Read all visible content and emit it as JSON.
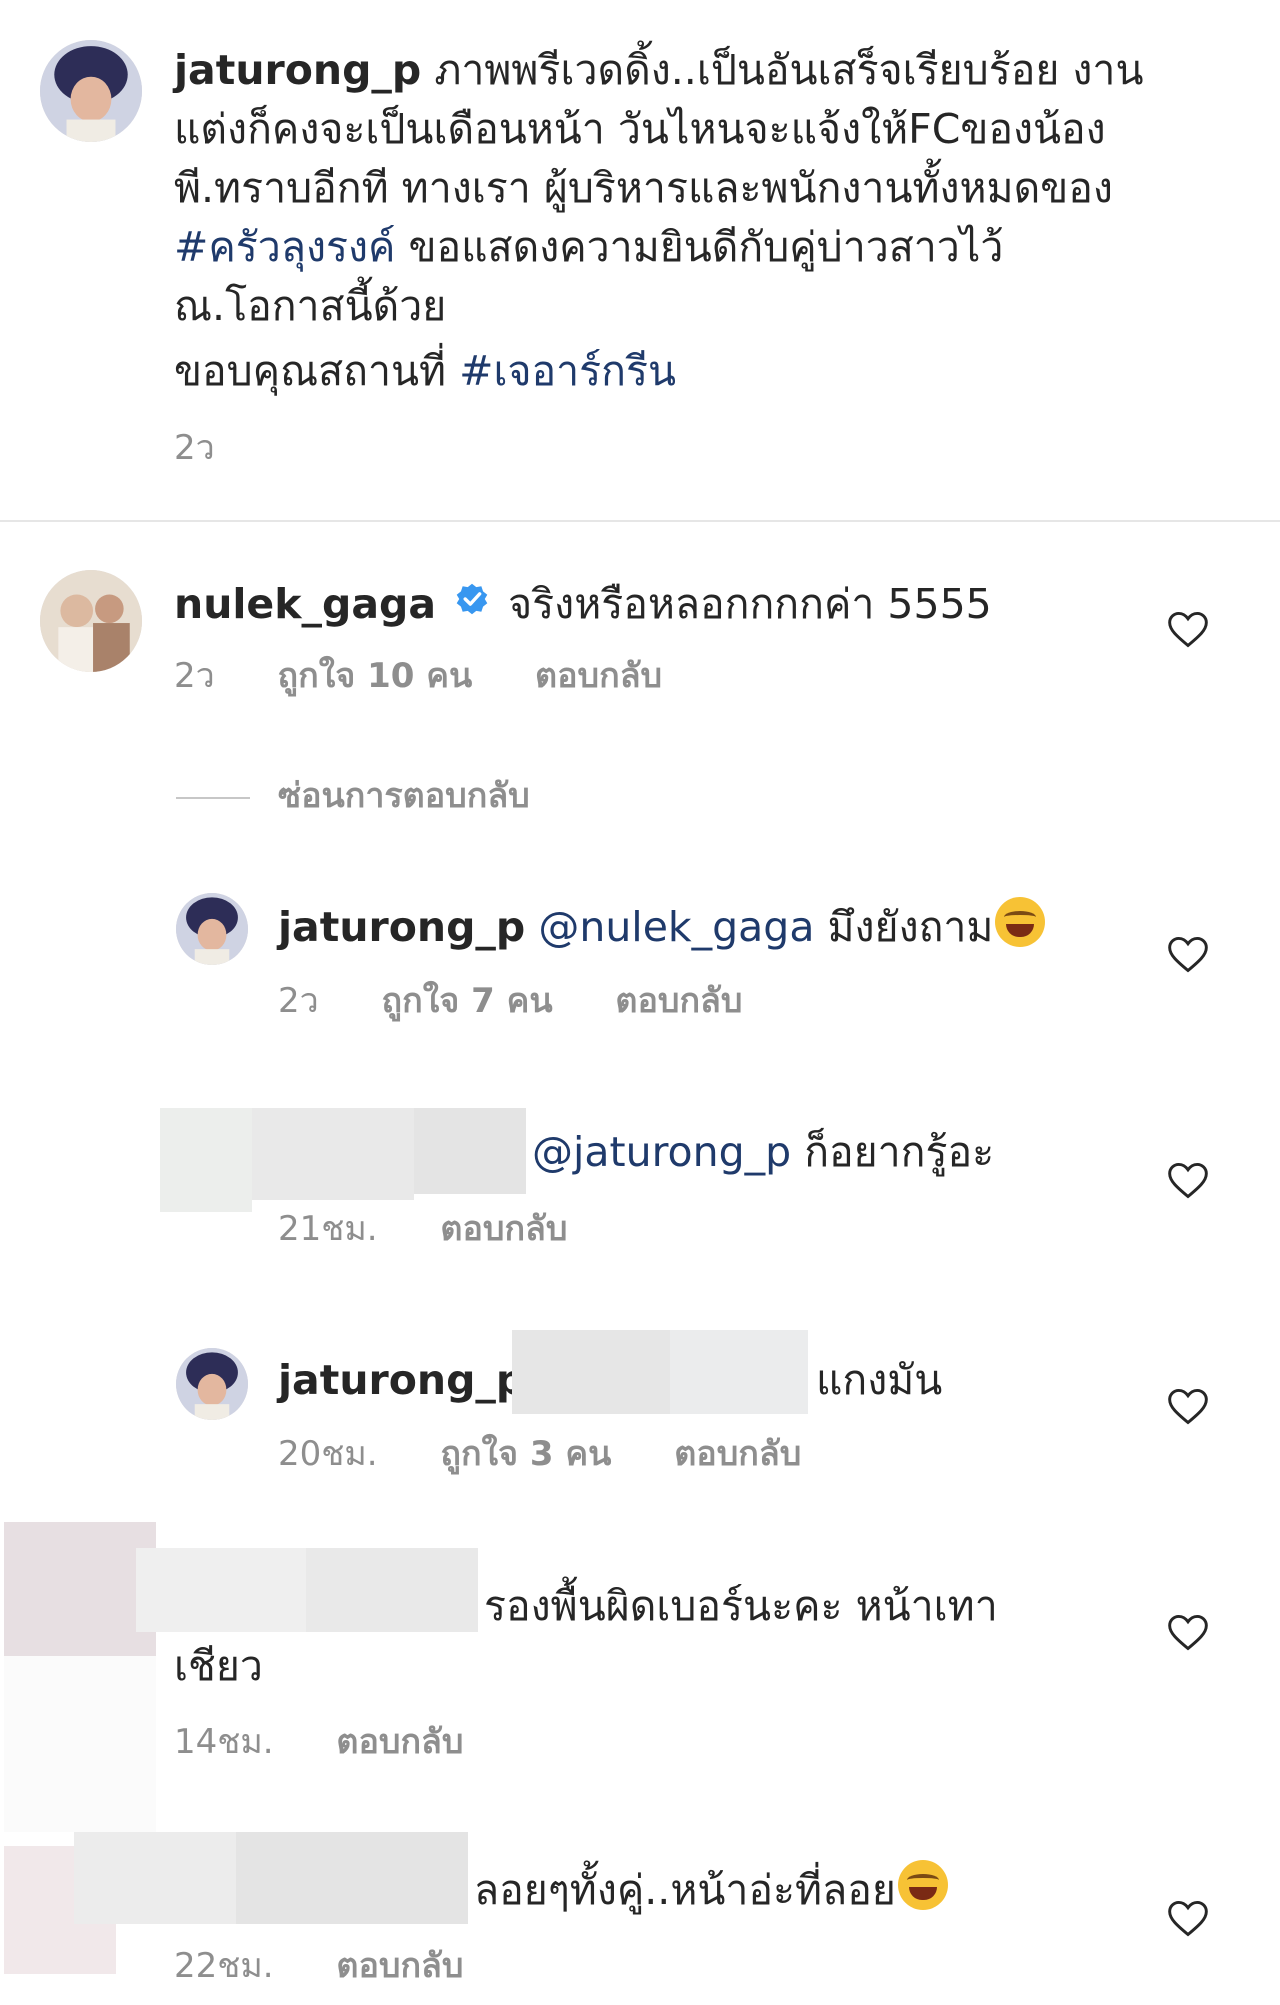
{
  "caption": {
    "username": "jaturong_p",
    "line1": "ภาพพรีเวดดิ้ง..เป็นอันเสร็จเรียบร้อย งาน",
    "line2": "แต่งก็คงจะเป็นเดือนหน้า วันไหนจะแจ้งให้FCของน้อง",
    "line3": "พี.ทราบอีกที ทางเรา ผู้บริหารและพนักงานทั้งหมดของ",
    "line4_tag": "#ครัวลุงรงค์",
    "line4_text": " ขอแสดงความยินดีกับคู่บ่าวสาวไว้",
    "line5": "ณ.โอกาสนี้ด้วย",
    "line6_text": "ขอบคุณสถานที่ ",
    "line6_tag": "#เจอาร์กรีน",
    "time": "2ว"
  },
  "comment1": {
    "username": "nulek_gaga",
    "text": "จริงหรือหลอกกกกค่า 5555",
    "time": "2ว",
    "likes": "ถูกใจ 10 คน",
    "reply": "ตอบกลับ",
    "hide_replies": "ซ่อนการตอบกลับ"
  },
  "reply1": {
    "username": "jaturong_p",
    "mention": "@nulek_gaga",
    "text": " มึงยังถาม",
    "time": "2ว",
    "likes": "ถูกใจ 7 คน",
    "reply": "ตอบกลับ"
  },
  "reply2": {
    "mention": "@jaturong_p",
    "text": " ก็อยากรู้อะ",
    "time": "21ชม.",
    "reply": "ตอบกลับ"
  },
  "reply3": {
    "username": "jaturong_p",
    "text": "แกงมัน",
    "time": "20ชม.",
    "likes": "ถูกใจ 3 คน",
    "reply": "ตอบกลับ"
  },
  "comment2": {
    "line1": "รองพื้นผิดเบอร์นะคะ หน้าเทา",
    "line2": "เชียว",
    "time": "14ชม.",
    "reply": "ตอบกลับ"
  },
  "comment3": {
    "text": "ลอยๆทั้งคู่..หน้าอ่ะที่ลอย",
    "time": "22ชม.",
    "reply": "ตอบกลับ"
  },
  "icons": {
    "heart": "heart-icon",
    "verified": "verified-badge-icon",
    "emoji": "tears-of-joy-emoji"
  },
  "colors": {
    "text": "#262626",
    "secondary": "#8e8e8e",
    "hashtag": "#1f3a6b",
    "verified": "#3897f0"
  }
}
